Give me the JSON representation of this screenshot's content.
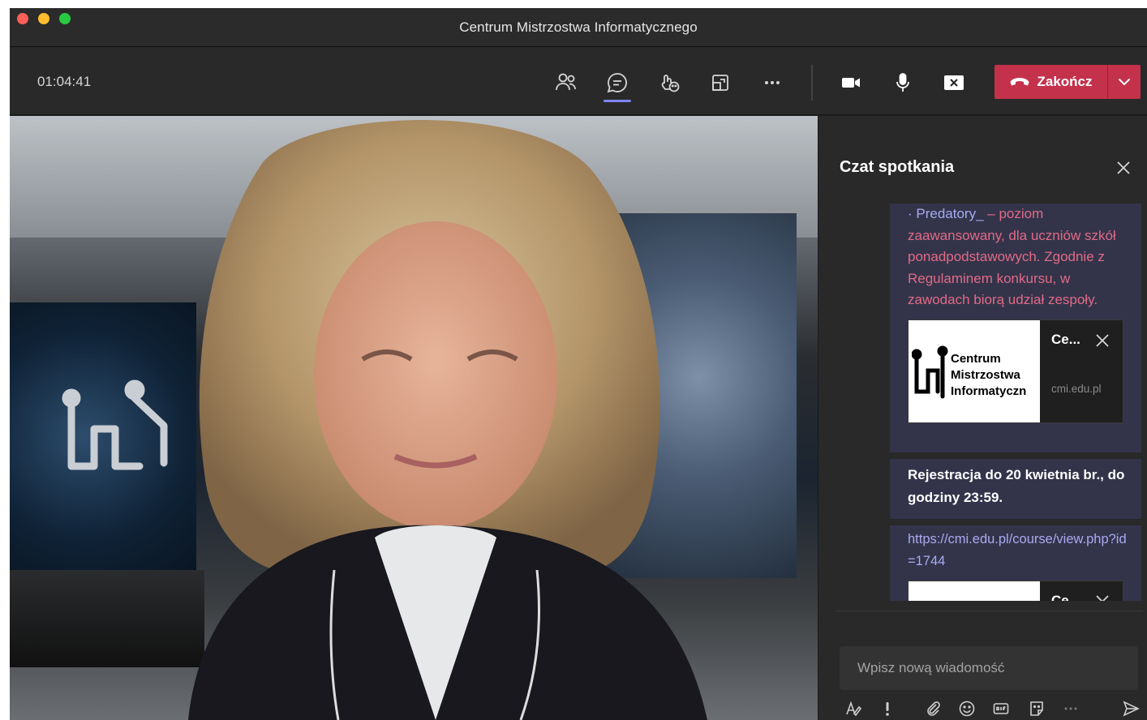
{
  "window": {
    "title": "Centrum Mistrzostwa Informatycznego"
  },
  "toolbar": {
    "timer": "01:04:41",
    "end_label": "Zakończ",
    "icons": [
      "people-icon",
      "chat-icon",
      "reactions-icon",
      "rooms-icon",
      "more-icon",
      "camera-icon",
      "mic-icon",
      "share-icon",
      "phone-icon",
      "chevron-down-icon"
    ]
  },
  "chat": {
    "title": "Czat spotkania",
    "messages": [
      {
        "prefix": "· Predatory_",
        "text": " – poziom zaawansowany, dla uczniów szkół ponadpodstawowych. Zgodnie z Regulaminem konkursu, w zawodach biorą udział zespoły.",
        "card": {
          "image_label": "Centrum Mistrzostwa Informatyczn",
          "title": "Ce...",
          "url": "cmi.edu.pl"
        }
      },
      {
        "bold_text": "Rejestracja do 20 kwietnia br., do godziny 23:59."
      },
      {
        "link": "https://cmi.edu.pl/course/view.php?id=1744",
        "card": {
          "title": "Ce..."
        }
      }
    ],
    "composer_placeholder": "Wpisz nową wiadomość",
    "composer_value": ""
  },
  "colors": {
    "accent": "#7f85f5",
    "end_call": "#c4314b",
    "message_bubble": "#33344a",
    "message_text": "#e26a86"
  }
}
